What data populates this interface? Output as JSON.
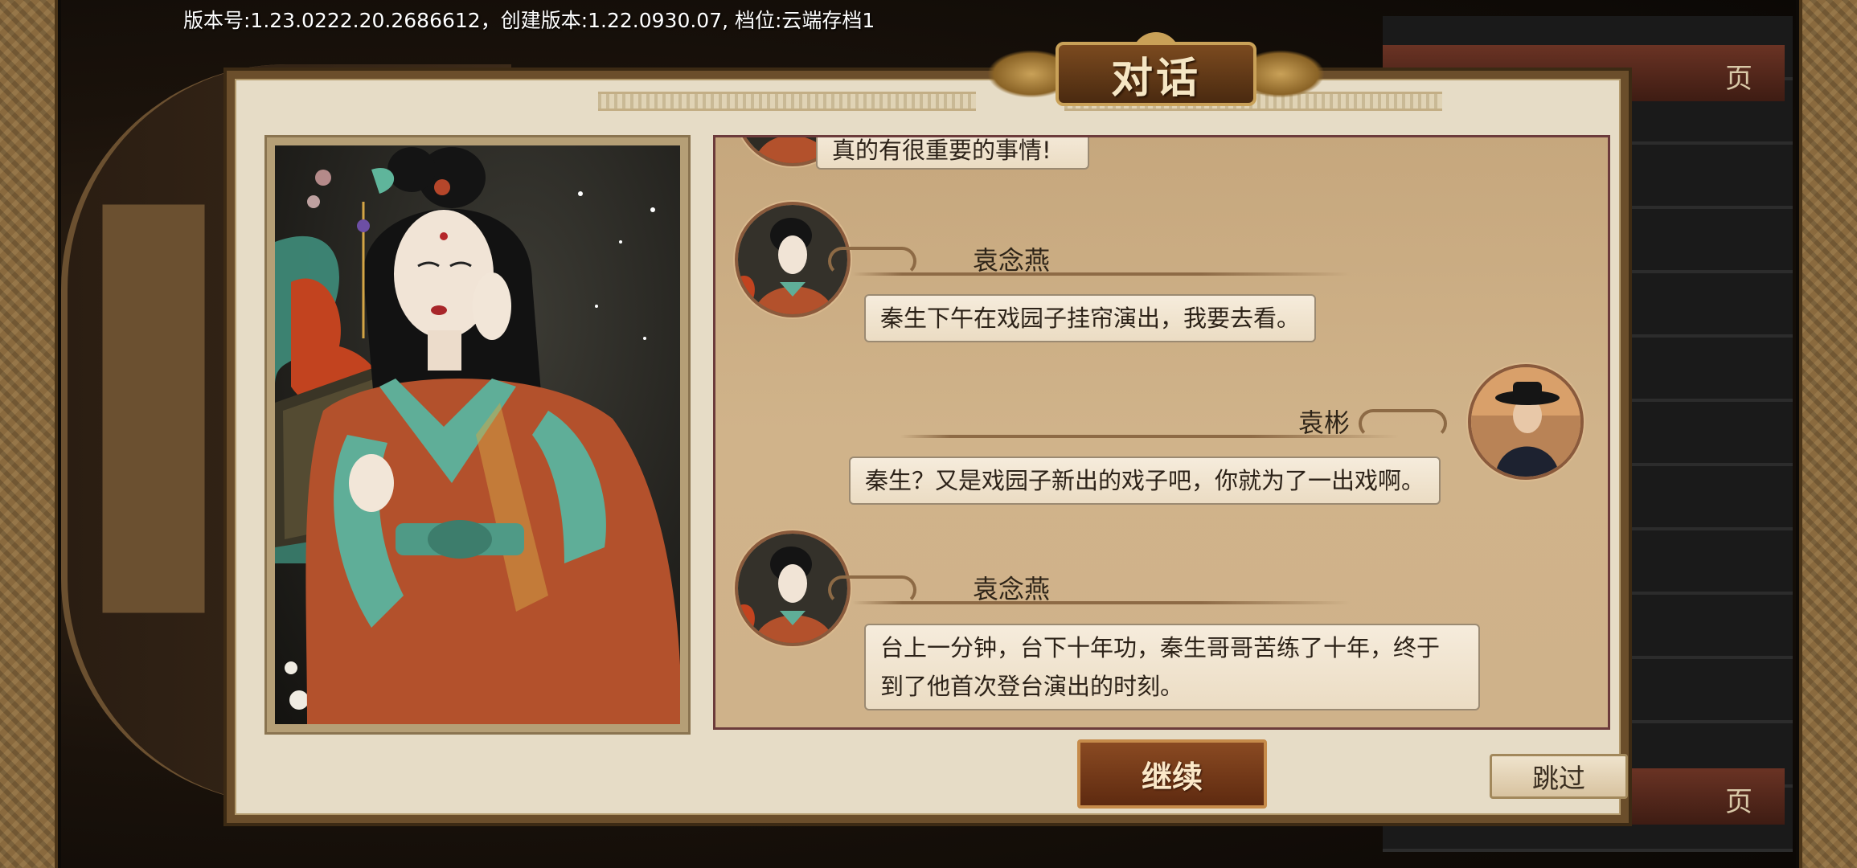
{
  "version_text": "版本号:1.23.0222.20.2686612，创建版本:1.22.0930.07, 档位:云端存档1",
  "background": {
    "tab_top": "页",
    "tab_bottom": "页"
  },
  "dialog": {
    "title": "对话",
    "messages": [
      {
        "speaker": "",
        "side": "left",
        "text": "真的有很重要的事情!"
      },
      {
        "speaker": "袁念燕",
        "side": "left",
        "text": "秦生下午在戏园子挂帘演出，我要去看。"
      },
      {
        "speaker": "袁彬",
        "side": "right",
        "text": "秦生？又是戏园子新出的戏子吧，你就为了一出戏啊。"
      },
      {
        "speaker": "袁念燕",
        "side": "left",
        "text_line1": "台上一分钟，台下十年功，秦生哥哥苦练了十年，终于",
        "text_line2": "到了他首次登台演出的时刻。"
      }
    ],
    "continue_label": "继续",
    "skip_label": "跳过"
  },
  "colors": {
    "frame": "#6b4e2b",
    "chat_bg": "#c6a77d",
    "chat_border": "#6c3b3b",
    "continue_bg": "#8a4a22"
  },
  "icons": {
    "avatar_left": "woman-portrait",
    "avatar_right": "man-in-hat-portrait"
  }
}
